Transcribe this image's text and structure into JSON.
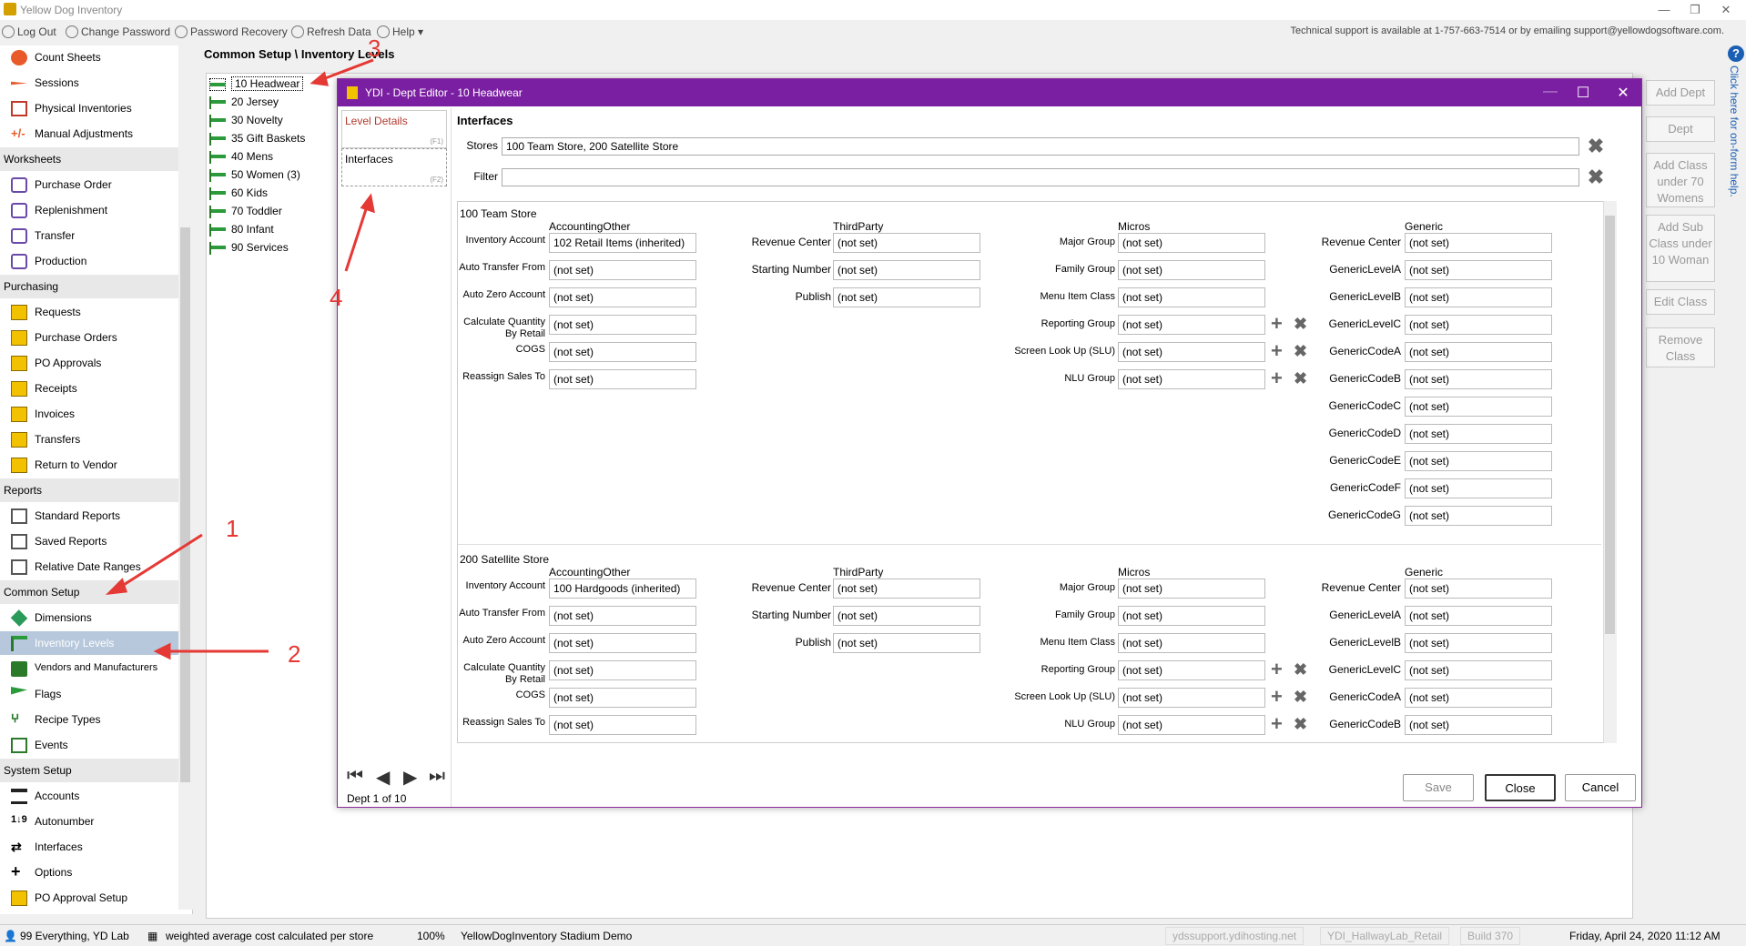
{
  "app": {
    "title": "Yellow Dog Inventory"
  },
  "menubar": {
    "items": [
      "Log Out",
      "Change Password",
      "Password Recovery",
      "Refresh Data",
      "Help"
    ],
    "support": "Technical support is available at 1-757-663-7514 or by emailing support@yellowdogsoftware.com."
  },
  "sidebar": {
    "top_items": [
      "Count Sheets",
      "Sessions",
      "Physical Inventories",
      "Manual Adjustments"
    ],
    "worksheets": {
      "title": "Worksheets",
      "items": [
        "Purchase Order",
        "Replenishment",
        "Transfer",
        "Production"
      ]
    },
    "purchasing": {
      "title": "Purchasing",
      "items": [
        "Requests",
        "Purchase Orders",
        "PO Approvals",
        "Receipts",
        "Invoices",
        "Transfers",
        "Return to Vendor"
      ]
    },
    "reports": {
      "title": "Reports",
      "items": [
        "Standard Reports",
        "Saved Reports",
        "Relative Date Ranges"
      ]
    },
    "common": {
      "title": "Common Setup",
      "items": [
        "Dimensions",
        "Inventory Levels",
        "Vendors and Manufacturers",
        "Flags",
        "Recipe Types",
        "Events"
      ]
    },
    "system": {
      "title": "System Setup",
      "items": [
        "Accounts",
        "Autonumber",
        "Interfaces",
        "Options",
        "PO Approval Setup"
      ]
    }
  },
  "breadcrumb": "Common Setup \\ Inventory Levels",
  "tree": [
    "10  Headwear",
    "20  Jersey",
    "30  Novelty",
    "35  Gift Baskets",
    "40  Mens",
    "50  Women (3)",
    "60  Kids",
    "70  Toddler",
    "80  Infant",
    "90  Services"
  ],
  "right_buttons": [
    "Add Dept",
    "Dept",
    "Add Class under 70 Womens",
    "Add Sub Class under 10 Woman",
    "Edit Class",
    "Remove Class"
  ],
  "help_text": "Click here for on-form help.",
  "dialog": {
    "title": "YDI - Dept Editor - 10 Headwear",
    "nav": [
      {
        "label": "Level Details",
        "key": "(F1)"
      },
      {
        "label": "Interfaces",
        "key": "(F2)"
      }
    ],
    "heading": "Interfaces",
    "stores_label": "Stores",
    "stores_value": "100 Team Store, 200 Satellite Store",
    "filter_label": "Filter",
    "filter_value": "",
    "groups": [
      "AccountingOther",
      "ThirdParty",
      "Micros",
      "Generic"
    ],
    "acct_labels": [
      "Inventory Account",
      "Auto Transfer From",
      "Auto Zero Account",
      "Calculate Quantity By Retail",
      "COGS",
      "Reassign Sales To"
    ],
    "tp_labels": [
      "Revenue Center",
      "Starting Number",
      "Publish"
    ],
    "micros_labels": [
      "Major Group",
      "Family Group",
      "Menu Item Class",
      "Reporting Group",
      "Screen Look Up (SLU)",
      "NLU Group"
    ],
    "generic_labels": [
      "Revenue Center",
      "GenericLevelA",
      "GenericLevelB",
      "GenericLevelC",
      "GenericCodeA",
      "GenericCodeB",
      "GenericCodeC",
      "GenericCodeD",
      "GenericCodeE",
      "GenericCodeF",
      "GenericCodeG"
    ],
    "not_set": "(not set)",
    "stores": [
      {
        "name": "100 Team Store",
        "inventory_account": "102 Retail Items (inherited)"
      },
      {
        "name": "200 Satellite Store",
        "inventory_account": "100 Hardgoods (inherited)"
      }
    ],
    "pager": "Dept 1 of 10",
    "buttons": {
      "save": "Save",
      "close": "Close",
      "cancel": "Cancel"
    }
  },
  "annotations": [
    "1",
    "2",
    "3",
    "4"
  ],
  "status": {
    "user": "99 Everything, YD Lab",
    "cost": "weighted average cost calculated per store",
    "zoom": "100%",
    "db": "YellowDogInventory Stadium Demo",
    "host": "ydssupport.ydihosting.net",
    "server": "YDI_HallwayLab_Retail",
    "build": "Build 370",
    "date": "Friday, April 24, 2020 11:12 AM"
  },
  "colors": {
    "dialog_title": "#7b1fa2",
    "annotation": "#e53935",
    "selected": "#b7c8dc"
  }
}
